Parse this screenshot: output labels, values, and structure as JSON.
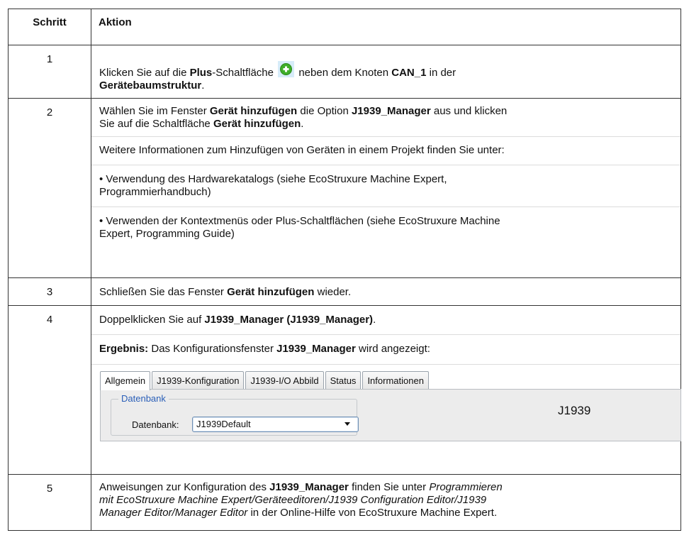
{
  "table": {
    "header": {
      "step": "Schritt",
      "action": "Aktion"
    },
    "rows": [
      {
        "step": "1",
        "p1_a": "Klicken Sie auf die ",
        "p1_b": "Plus",
        "p1_c": "-Schaltfläche",
        "p1_d": " neben dem Knoten ",
        "p1_e": "CAN_1",
        "p1_f": " in der",
        "p1_g": "Gerätebaumstruktur",
        "p1_h": ".",
        "icon": "plus-circle-icon"
      },
      {
        "step": "2",
        "p1_a": "Wählen Sie im Fenster ",
        "p1_b": "Gerät hinzufügen",
        "p1_c": " die Option ",
        "p1_d": "J1939_Manager",
        "p1_e": " aus und klicken",
        "p1_f": "Sie auf die Schaltfläche ",
        "p1_g": "Gerät hinzufügen",
        "p1_h": ".",
        "p2": "Weitere Informationen zum Hinzufügen von Geräten in einem Projekt finden Sie unter:",
        "p3_a": "• Verwendung des Hardwarekatalogs (siehe EcoStruxure Machine Expert,",
        "p3_b": "Programmierhandbuch)",
        "p4_a": "• Verwenden der Kontextmenüs oder Plus-Schaltflächen (siehe EcoStruxure Machine",
        "p4_b": "Expert, Programming Guide)"
      },
      {
        "step": "3",
        "a": "Schließen Sie das Fenster ",
        "b": "Gerät hinzufügen",
        "c": " wieder."
      },
      {
        "step": "4",
        "p1_a": "Doppelklicken Sie auf ",
        "p1_b": "J1939_Manager (J1939_Manager)",
        "p1_c": ".",
        "p2_a": "Ergebnis:",
        "p2_b": " Das Konfigurationsfenster ",
        "p2_c": "J1939_Manager",
        "p2_d": " wird angezeigt:",
        "config": {
          "tabs": [
            "Allgemein",
            "J1939-Konfiguration",
            "J1939-I/O Abbild",
            "Status",
            "Informationen"
          ],
          "group_legend": "Datenbank",
          "field_label": "Datenbank:",
          "field_value": "J1939Default",
          "side_title": "J1939"
        }
      },
      {
        "step": "5",
        "a": "Anweisungen zur Konfiguration des ",
        "b": "J1939_Manager",
        "c": " finden Sie unter ",
        "d": "Programmieren",
        "e": "mit EcoStruxure Machine Expert/Geräteeditoren/J1939 Configuration Editor/J1939",
        "f": "Manager Editor/Manager Editor",
        "g": " in der Online-Hilfe von EcoStruxure Machine Expert."
      }
    ]
  },
  "colors": {
    "border": "#333333",
    "icon_green": "#3fae2a",
    "legend_blue": "#2a5fb8"
  }
}
